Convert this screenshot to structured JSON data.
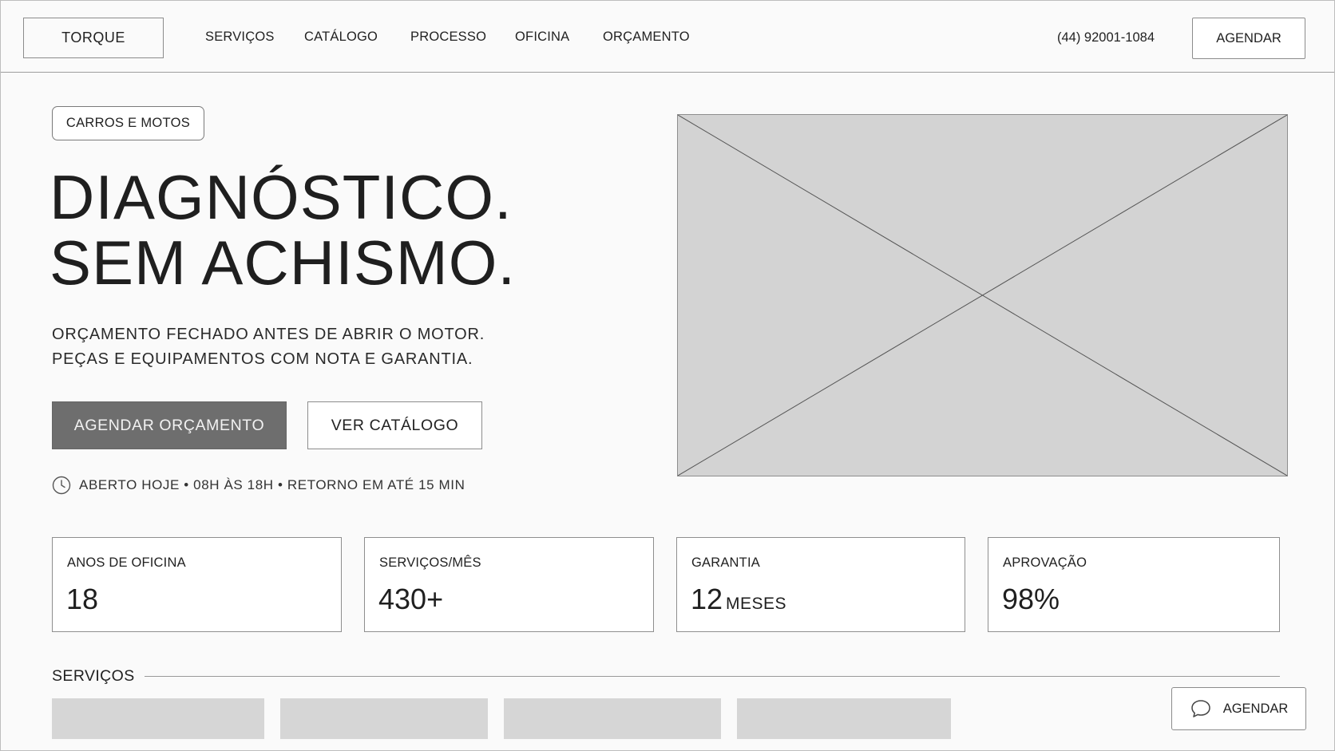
{
  "header": {
    "logo": "TORQUE",
    "nav": [
      "SERVIÇOS",
      "CATÁLOGO",
      "PROCESSO",
      "OFICINA",
      "ORÇAMENTO"
    ],
    "phone": "(44) 92001-1084",
    "cta": "AGENDAR"
  },
  "hero": {
    "chip": "CARROS E MOTOS",
    "headline": [
      "DIAGNÓSTICO.",
      "SEM ACHISMO."
    ],
    "sub": [
      "ORÇAMENTO FECHADO ANTES DE ABRIR O MOTOR.",
      "PEÇAS E EQUIPAMENTOS COM NOTA E GARANTIA."
    ],
    "primary_button": "AGENDAR ORÇAMENTO",
    "secondary_button": "VER CATÁLOGO",
    "hours": "ABERTO HOJE • 08H ÀS 18H • RETORNO EM ATÉ 15 MIN",
    "image": "image-placeholder"
  },
  "stats": [
    {
      "label": "ANOS DE OFICINA",
      "value": "18",
      "unit": ""
    },
    {
      "label": "SERVIÇOS/MÊS",
      "value": "430+",
      "unit": ""
    },
    {
      "label": "GARANTIA",
      "value": "12",
      "unit": "MESES"
    },
    {
      "label": "APROVAÇÃO",
      "value": "98%",
      "unit": ""
    }
  ],
  "services": {
    "title": "SERVIÇOS",
    "cards": 4
  },
  "floating_cta": {
    "label": "AGENDAR",
    "icon": "chat-icon"
  },
  "colors": {
    "background": "#fafafa",
    "primary_button": "#6e6e6e",
    "placeholder": "#d3d3d3",
    "border": "#8e8e8e"
  }
}
